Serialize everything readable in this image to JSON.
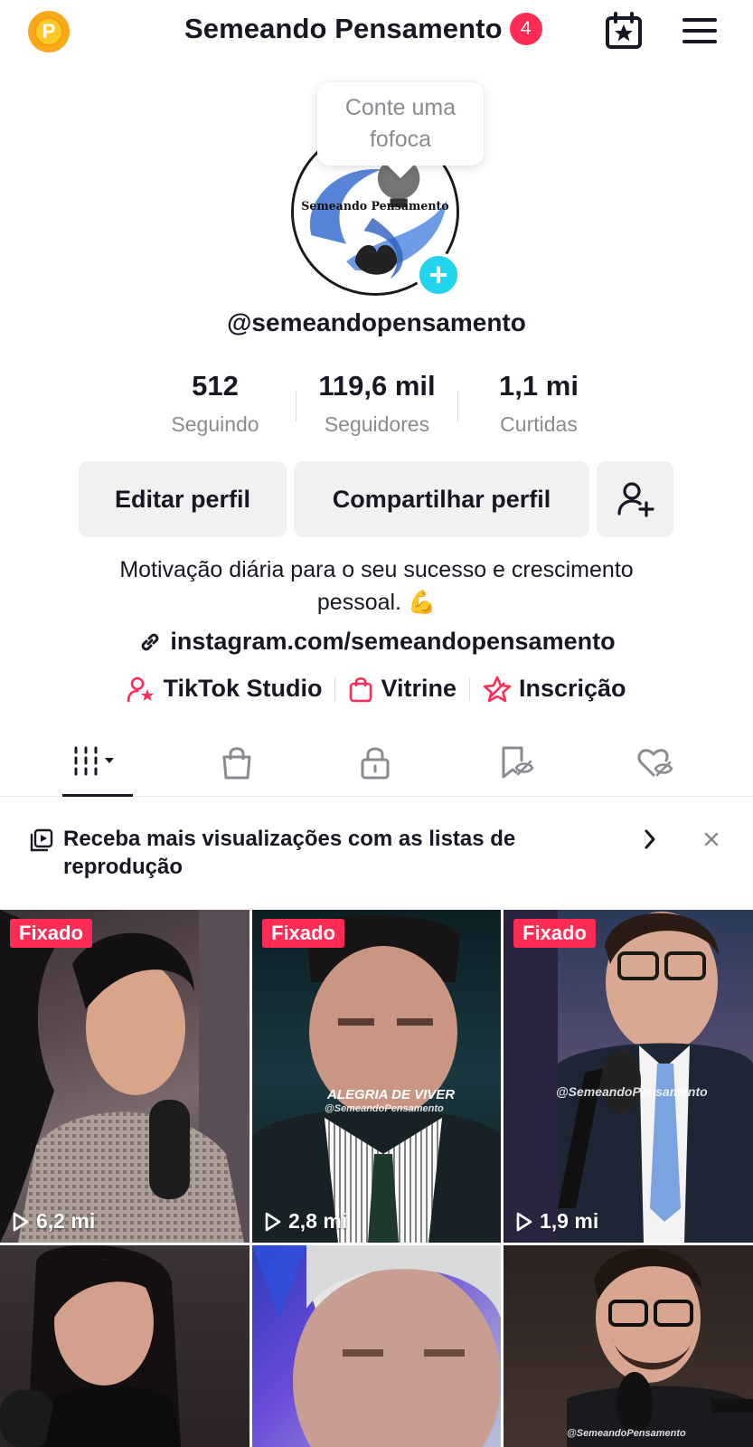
{
  "header": {
    "coin_letter": "P",
    "title": "Semeando Pensamento",
    "notification_count": "4",
    "calendar_icon": "calendar-star-icon",
    "menu_icon": "hamburger-menu-icon"
  },
  "tooltip": {
    "text_line1": "Conte uma",
    "text_line2": "fofoca"
  },
  "avatar": {
    "logo_text": "Semeando Pensamento",
    "add_icon": "+"
  },
  "profile": {
    "username": "@semeandopensamento"
  },
  "stats": [
    {
      "value": "512",
      "label": "Seguindo"
    },
    {
      "value": "119,6 mil",
      "label": "Seguidores"
    },
    {
      "value": "1,1 mi",
      "label": "Curtidas"
    }
  ],
  "actions": {
    "edit_label": "Editar perfil",
    "share_label": "Compartilhar perfil",
    "add_friend_icon": "person-plus-icon"
  },
  "bio": {
    "line1": "Motivação diária para o seu sucesso e crescimento",
    "line2": "pessoal. 💪",
    "link": "instagram.com/semeandopensamento"
  },
  "tools": [
    {
      "label": "TikTok Studio",
      "icon": "person-star-icon"
    },
    {
      "label": "Vitrine",
      "icon": "shopping-bag-icon"
    },
    {
      "label": "Inscrição",
      "icon": "subscription-star-icon"
    }
  ],
  "tabs": [
    {
      "name": "videos",
      "icon": "grid-columns-icon",
      "active": true
    },
    {
      "name": "shop",
      "icon": "shopping-bag-icon"
    },
    {
      "name": "private",
      "icon": "lock-icon"
    },
    {
      "name": "favorites",
      "icon": "bookmark-hidden-icon"
    },
    {
      "name": "liked",
      "icon": "heart-hidden-icon"
    }
  ],
  "promo": {
    "text": "Receba mais visualizações com as listas de reprodução",
    "icon": "playlist-icon"
  },
  "videos": [
    {
      "pinned": "Fixado",
      "views": "6,2 mi"
    },
    {
      "pinned": "Fixado",
      "views": "2,8 mi",
      "caption": "ALEGRIA DE VIVER",
      "watermark": "@SemeandoPensamento"
    },
    {
      "pinned": "Fixado",
      "views": "1,9 mi",
      "watermark": "@SemeandoPensamento"
    },
    {
      "views": ""
    },
    {
      "views": ""
    },
    {
      "views": "",
      "watermark": "@SemeandoPensamento"
    }
  ],
  "colors": {
    "accent": "#fe2c55",
    "teal": "#20d5ec",
    "coin": "#f7a91a",
    "muted": "#8a8b91"
  }
}
